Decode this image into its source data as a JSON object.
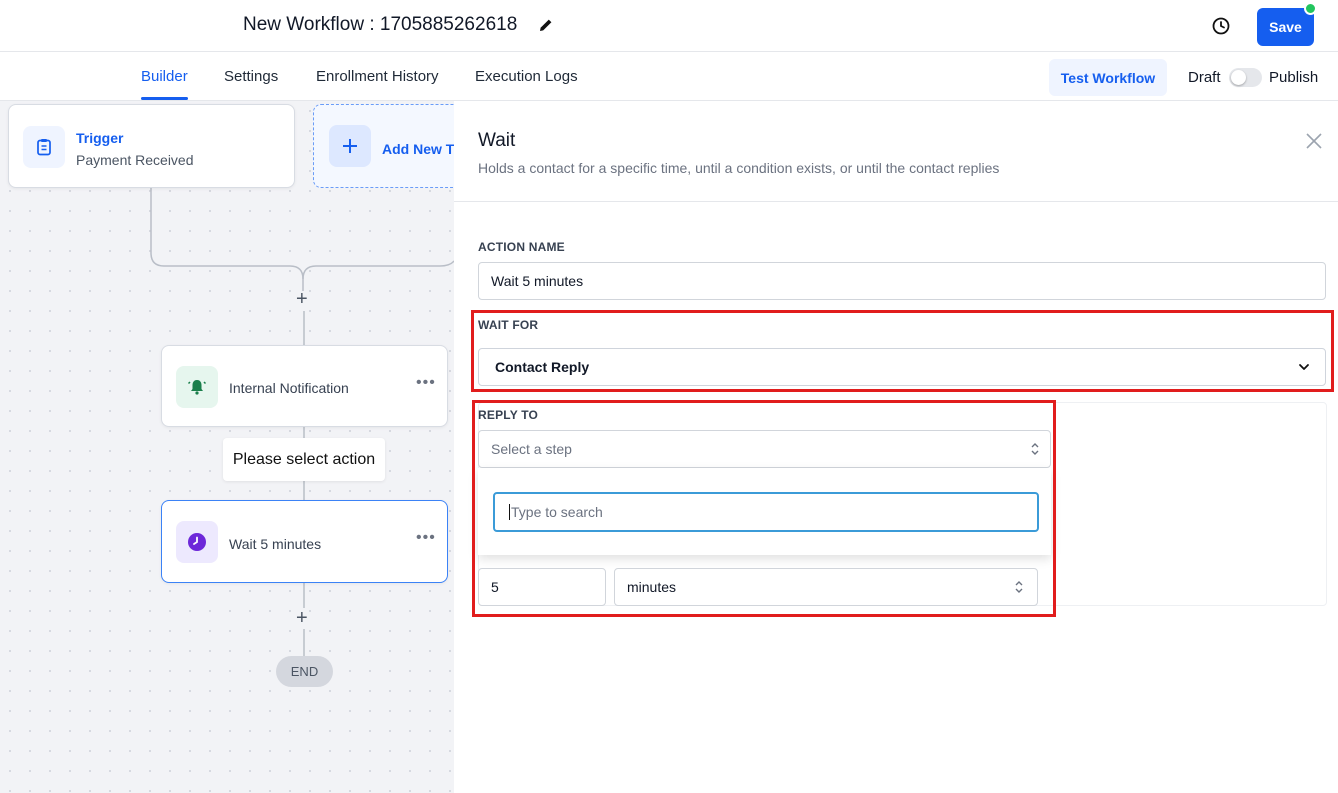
{
  "header": {
    "title": "New Workflow : 1705885262618",
    "save_label": "Save"
  },
  "tabs": {
    "builder": "Builder",
    "settings": "Settings",
    "enrollment": "Enrollment History",
    "logs": "Execution Logs",
    "test_workflow": "Test Workflow",
    "draft": "Draft",
    "publish": "Publish"
  },
  "canvas": {
    "trigger_title": "Trigger",
    "trigger_sub": "Payment Received",
    "add_trigger": "Add New T",
    "internal_notification": "Internal Notification",
    "tooltip": "Please select action",
    "wait_node": "Wait 5 minutes",
    "end": "END"
  },
  "panel": {
    "title": "Wait",
    "subtitle": "Holds a contact for a specific time, until a condition exists, or until the contact replies",
    "action_name_label": "ACTION NAME",
    "action_name_value": "Wait 5 minutes",
    "wait_for_label": "WAIT FOR",
    "wait_for_value": "Contact Reply",
    "reply_to_label": "REPLY TO",
    "reply_to_placeholder": "Select a step",
    "search_placeholder": "Type to search",
    "timeout_value": "5",
    "timeout_unit": "minutes"
  },
  "colors": {
    "accent": "#155eef",
    "highlight": "#e11d1d",
    "notification_green": "#1a7f4b",
    "wait_purple": "#6d28d9"
  }
}
